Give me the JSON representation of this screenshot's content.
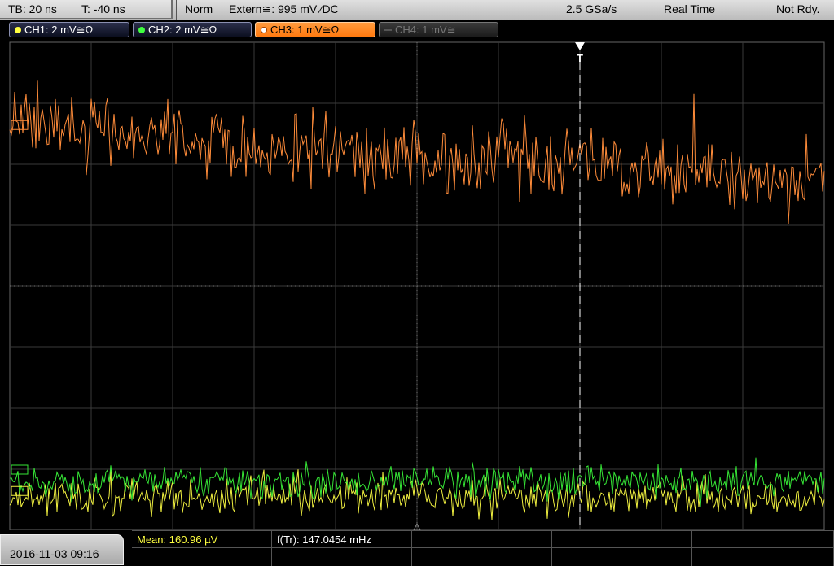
{
  "timebase": {
    "tb": "TB: 20 ns",
    "offset": "T: -40 ns"
  },
  "status": {
    "mode": "Norm",
    "trigger": "Extern≅: 995 mV ⁄DC",
    "sample_rate": "2.5 GSa/s",
    "acq_mode": "Real Time",
    "state": "Not Rdy."
  },
  "channels": [
    {
      "label": "CH1: 2 mV≅Ω",
      "color": "#ffff40"
    },
    {
      "label": "CH2: 2 mV≅Ω",
      "color": "#40ff40"
    },
    {
      "label": "CH3: 1 mV≅Ω",
      "color": "#ff8c2a"
    },
    {
      "label": "CH4: 1 mV≅",
      "color": "#777777"
    }
  ],
  "trigger_marker": "T",
  "traces": {
    "ch3": {
      "color": "#ff8c3a",
      "start_div": 1.2,
      "end_div": 2.25,
      "noise_div": 0.4
    },
    "ch2": {
      "color": "#36e636",
      "level_div": 7.2,
      "noise_div": 0.18
    },
    "ch1": {
      "color": "#f0f040",
      "level_div": 7.45,
      "noise_div": 0.2
    }
  },
  "bottom": {
    "datetime": "2016-11-03 09:16",
    "mean": "Mean: 160.96 µV",
    "freq": "f(Tr): 147.0454 mHz"
  }
}
